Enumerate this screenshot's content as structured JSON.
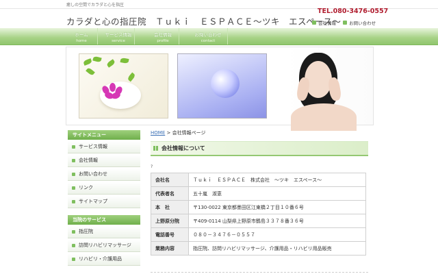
{
  "header": {
    "tagline": "癒しの空間でカラダと心を指圧",
    "site_title": "カラダと心の指圧院　Ｔｕｋｉ　ＥＳＰＡＣＥ～ツキ　エスペース～",
    "tel": "TEL.080-3476-0557",
    "links": [
      {
        "label": "会社情報",
        "icon": "square-bullet-icon"
      },
      {
        "label": "お問い合わせ",
        "icon": "square-bullet-icon"
      }
    ]
  },
  "nav": {
    "items": [
      {
        "ja": "ホーム",
        "en": "home"
      },
      {
        "ja": "サービス情報",
        "en": "service"
      },
      {
        "ja": "会社情報",
        "en": "profile"
      },
      {
        "ja": "お問い合わせ",
        "en": "contact"
      }
    ]
  },
  "sidebar": {
    "menu_title": "サイトメニュー",
    "menu_items": [
      "サービス情報",
      "会社情報",
      "お問い合わせ",
      "リンク",
      "サイトマップ"
    ],
    "service_title": "当院のサービス",
    "service_items": [
      "指圧院",
      "訪問リハビリマッサージ",
      "リハビリ・介護用品"
    ]
  },
  "breadcrumb": {
    "home": "HOME",
    "separator": " > ",
    "current": "会社情報ページ"
  },
  "main": {
    "section_title": "会社情報について",
    "stray_mark": "?",
    "table": [
      {
        "label": "会社名",
        "value": "Ｔｕｋｉ　ＥＳＰＡＣＥ　株式会社　～ツキ　エスペース～"
      },
      {
        "label": "代表者名",
        "value": "五十嵐　淑恵"
      },
      {
        "label": "本　社",
        "value": "〒130-0022 東京都墨田区江東橋２丁目１０番６号"
      },
      {
        "label": "上野原分院",
        "value": "〒409-0114 山梨県上野原市鶴島３３７８番３６号"
      },
      {
        "label": "電話番号",
        "value": "０８０－３４７６－０５５７"
      },
      {
        "label": "業務内容",
        "value": "指圧院、訪問リハビリマッサージ、介護用品・リハビリ用品販売"
      }
    ]
  },
  "colors": {
    "accent_green": "#8cc56a",
    "tel_red": "#b01c2e",
    "link_blue": "#3a6fb5"
  }
}
